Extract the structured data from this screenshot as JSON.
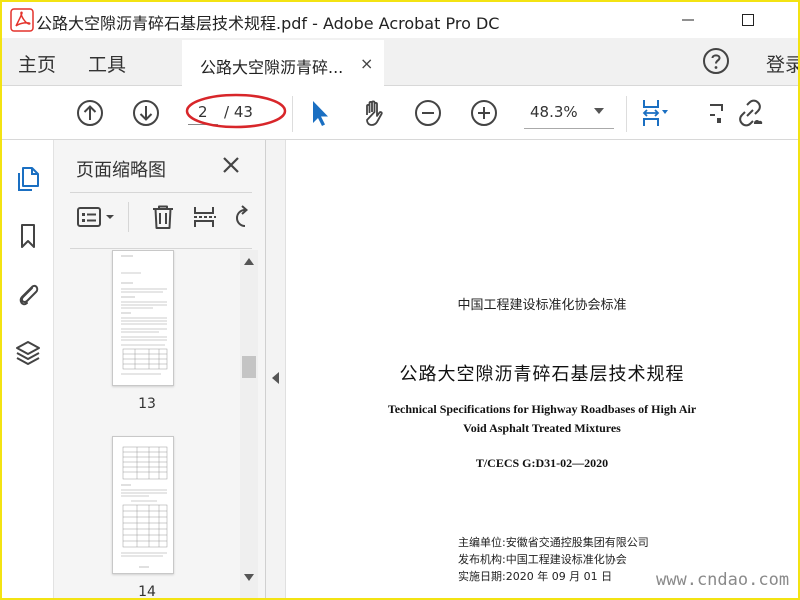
{
  "window": {
    "title": "公路大空隙沥青碎石基层技术规程.pdf - Adobe Acrobat Pro DC",
    "brand_color": "#e4322b"
  },
  "menubar": {
    "home_label": "主页",
    "tools_label": "工具",
    "tab_label": "公路大空隙沥青碎...",
    "tab_close": "×",
    "login_label": "登录"
  },
  "toolbar": {
    "page_current": "2",
    "page_total": "/ 43",
    "zoom": "48.3%",
    "accent_color": "#1a6fc2"
  },
  "panel": {
    "title": "页面缩略图",
    "thumbnails": [
      {
        "label": "13"
      },
      {
        "label": "14"
      }
    ]
  },
  "document": {
    "org_line": "中国工程建设标准化协会标准",
    "title_zh": "公路大空隙沥青碎石基层技术规程",
    "title_en_1": "Technical Specifications for Highway Roadbases of High Air",
    "title_en_2": "Void Asphalt Treated Mixtures",
    "code": "T/CECS G:D31-02—2020",
    "editor": "主编单位:安徽省交通控股集团有限公司",
    "publisher": "发布机构:中国工程建设标准化协会",
    "date": "实施日期:2020 年 09 月 01 日"
  },
  "watermark": "www.cndao.com",
  "icons": [
    "acrobat-logo-icon",
    "minimize-icon",
    "maximize-icon",
    "help-icon",
    "prev-page-icon",
    "next-page-icon",
    "select-arrow-icon",
    "hand-icon",
    "zoom-out-icon",
    "zoom-in-icon",
    "fit-page-icon",
    "comment-icon",
    "link-icon",
    "pages-icon",
    "bookmark-icon",
    "attachment-icon",
    "layers-icon",
    "options-icon",
    "delete-icon",
    "extract-icon",
    "rotate-icon",
    "close-icon"
  ]
}
